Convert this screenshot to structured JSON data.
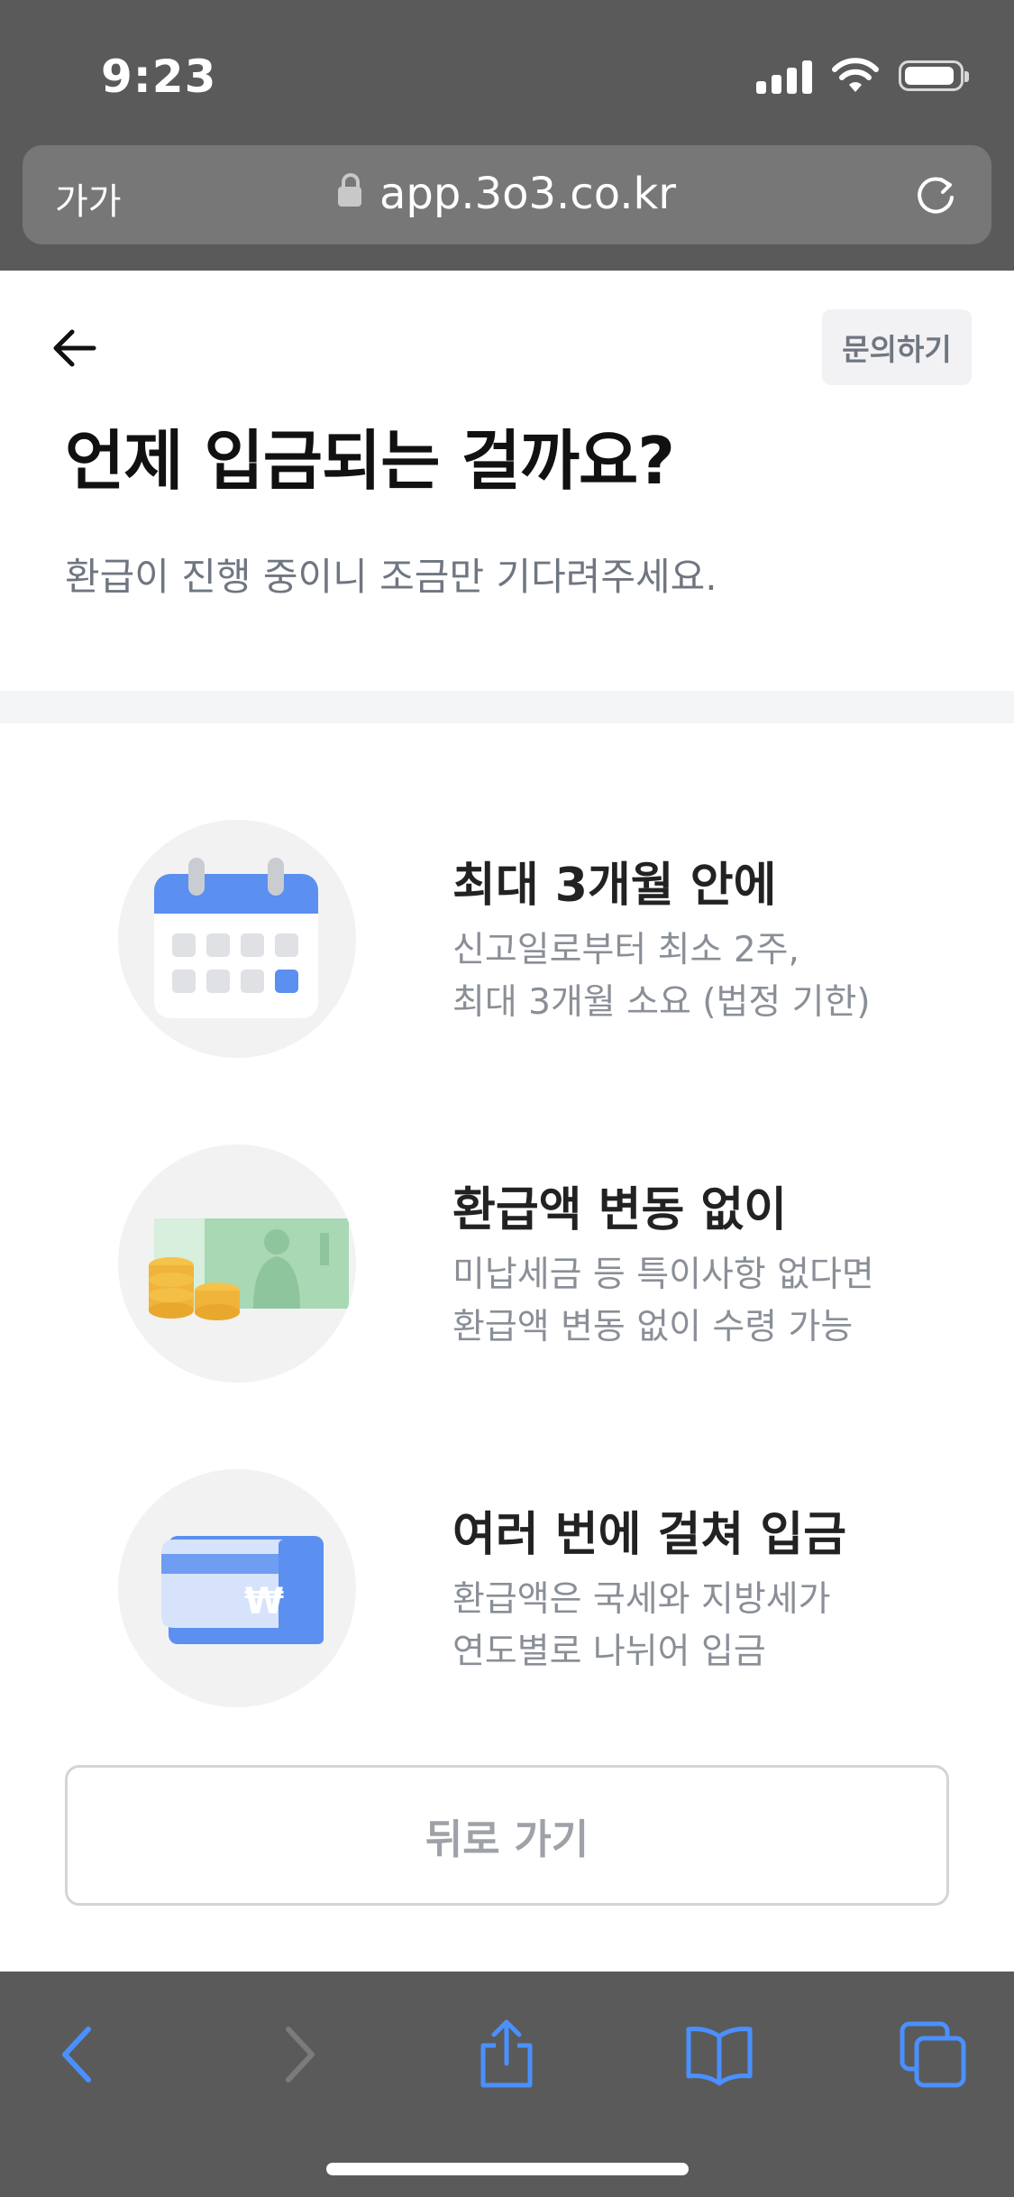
{
  "status_bar": {
    "time": "9:23"
  },
  "browser": {
    "text_size_label": "가가",
    "url": "app.3o3.co.kr"
  },
  "header": {
    "inquiry_label": "문의하기",
    "title": "언제 입금되는 걸까요?",
    "subtitle": "환급이 진행 중이니 조금만 기다려주세요."
  },
  "info_items": [
    {
      "icon": "calendar-icon",
      "title": "최대 3개월 안에",
      "desc_lines": [
        "신고일로부터 최소 2주,",
        "최대 3개월 소요 (법정 기한)"
      ]
    },
    {
      "icon": "money-icon",
      "title": "환급액 변동 없이",
      "desc_lines": [
        "미납세금 등 특이사항 없다면",
        "환급액 변동 없이 수령 가능"
      ]
    },
    {
      "icon": "card-icon",
      "title": "여러 번에 걸쳐 입금",
      "desc_lines": [
        "환급액은 국세와 지방세가",
        "연도별로 나뉘어 입금"
      ]
    }
  ],
  "footer": {
    "back_label": "뒤로 가기"
  },
  "colors": {
    "accent_blue": "#5b8ff0",
    "safari_chrome": "#5a5a5a",
    "toolbar_icon_blue": "#4a90ff"
  }
}
